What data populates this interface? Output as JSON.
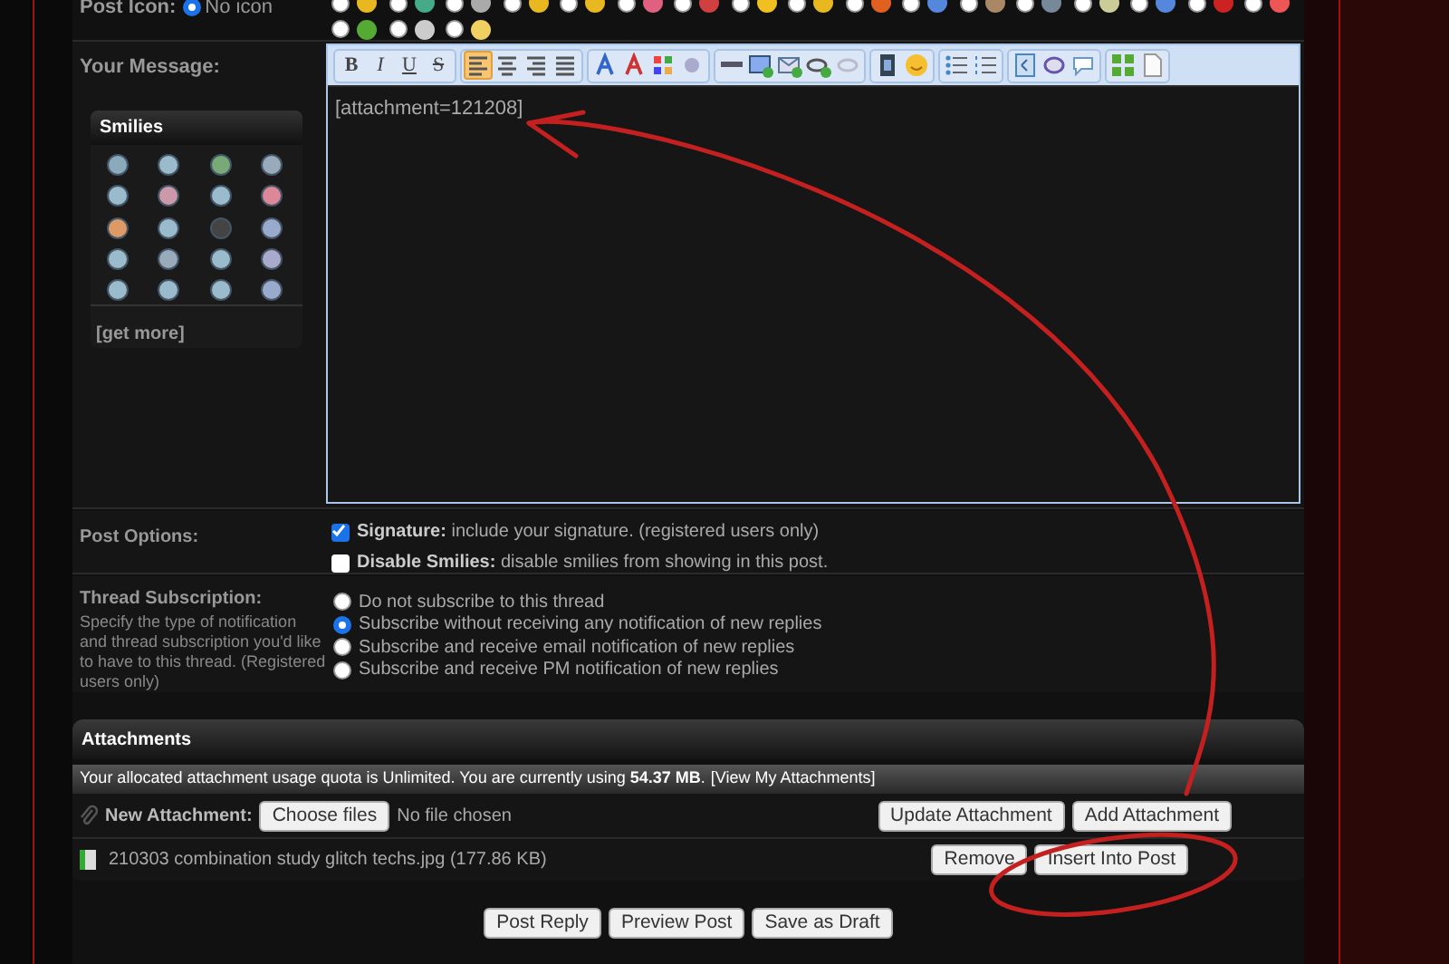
{
  "post_icon": {
    "label": "Post Icon:",
    "no_icon": {
      "label": "No icon",
      "selected": true
    },
    "icons": [
      {
        "selected": false
      },
      {
        "selected": false
      },
      {
        "selected": false
      },
      {
        "selected": false
      },
      {
        "selected": false
      },
      {
        "selected": false
      },
      {
        "selected": false
      },
      {
        "selected": false
      },
      {
        "selected": false
      },
      {
        "selected": false
      },
      {
        "selected": false
      },
      {
        "selected": false
      },
      {
        "selected": false
      },
      {
        "selected": false
      },
      {
        "selected": false
      },
      {
        "selected": false
      },
      {
        "selected": false
      },
      {
        "selected": false
      },
      {
        "selected": false
      },
      {
        "selected": false
      }
    ]
  },
  "message": {
    "label": "Your Message:",
    "smilies": {
      "title": "Smilies",
      "more": "[get more]"
    },
    "toolbar": [
      {
        "buttons": [
          {
            "kind": "text",
            "label": "B",
            "selected": false
          },
          {
            "kind": "text",
            "label": "I",
            "selected": false
          },
          {
            "kind": "text",
            "label": "U",
            "selected": false
          },
          {
            "kind": "text",
            "label": "S",
            "selected": false
          }
        ]
      },
      {
        "buttons": [
          {
            "kind": "icon",
            "selected": true
          },
          {
            "kind": "icon",
            "selected": false
          },
          {
            "kind": "icon",
            "selected": false
          },
          {
            "kind": "icon",
            "selected": false
          }
        ]
      },
      {
        "buttons": [
          {
            "kind": "icon",
            "selected": false
          },
          {
            "kind": "icon",
            "selected": false
          },
          {
            "kind": "icon",
            "selected": false
          },
          {
            "kind": "icon",
            "selected": false
          }
        ]
      },
      {
        "buttons": [
          {
            "kind": "icon",
            "selected": false
          },
          {
            "kind": "icon",
            "selected": false
          },
          {
            "kind": "icon",
            "selected": false
          },
          {
            "kind": "icon",
            "selected": false
          },
          {
            "kind": "icon",
            "selected": false
          }
        ]
      },
      {
        "buttons": [
          {
            "kind": "icon",
            "selected": false
          },
          {
            "kind": "icon",
            "selected": false
          }
        ]
      },
      {
        "buttons": [
          {
            "kind": "icon",
            "selected": false
          },
          {
            "kind": "icon",
            "selected": false
          }
        ]
      },
      {
        "buttons": [
          {
            "kind": "icon",
            "selected": false
          },
          {
            "kind": "icon",
            "selected": false
          },
          {
            "kind": "icon",
            "selected": false
          }
        ]
      },
      {
        "buttons": [
          {
            "kind": "icon",
            "selected": false
          },
          {
            "kind": "icon",
            "selected": false
          }
        ]
      }
    ],
    "text": "[attachment=121208]"
  },
  "post_options": {
    "label": "Post Options:",
    "options": [
      {
        "name": "Signature:",
        "desc": "include your signature. (registered users only)",
        "checked": true
      },
      {
        "name": "Disable Smilies:",
        "desc": "disable smilies from showing in this post.",
        "checked": false
      }
    ]
  },
  "subscription": {
    "label": "Thread Subscription:",
    "help": "Specify the type of notification and thread subscription you'd like to have to this thread. (Registered users only)",
    "options": [
      {
        "label": "Do not subscribe to this thread",
        "selected": false
      },
      {
        "label": "Subscribe without receiving any notification of new replies",
        "selected": true
      },
      {
        "label": "Subscribe and receive email notification of new replies",
        "selected": false
      },
      {
        "label": "Subscribe and receive PM notification of new replies",
        "selected": false
      }
    ]
  },
  "attachments": {
    "title": "Attachments",
    "quota": "Your allocated attachment usage quota is Unlimited. You are currently using **54.37 MB**.",
    "quota_link": "[View My Attachments]",
    "new_label": "New Attachment:",
    "choose": "Choose files",
    "no_file": "No file chosen",
    "new_buttons": [
      "Update Attachment",
      "Add Attachment"
    ],
    "files": [
      {
        "name": "210303 combination study glitch techs.jpg (177.86 KB)",
        "buttons": [
          "Remove",
          "Insert Into Post"
        ]
      }
    ]
  },
  "buttons": [
    "Post Reply",
    "Preview Post",
    "Save as Draft"
  ]
}
